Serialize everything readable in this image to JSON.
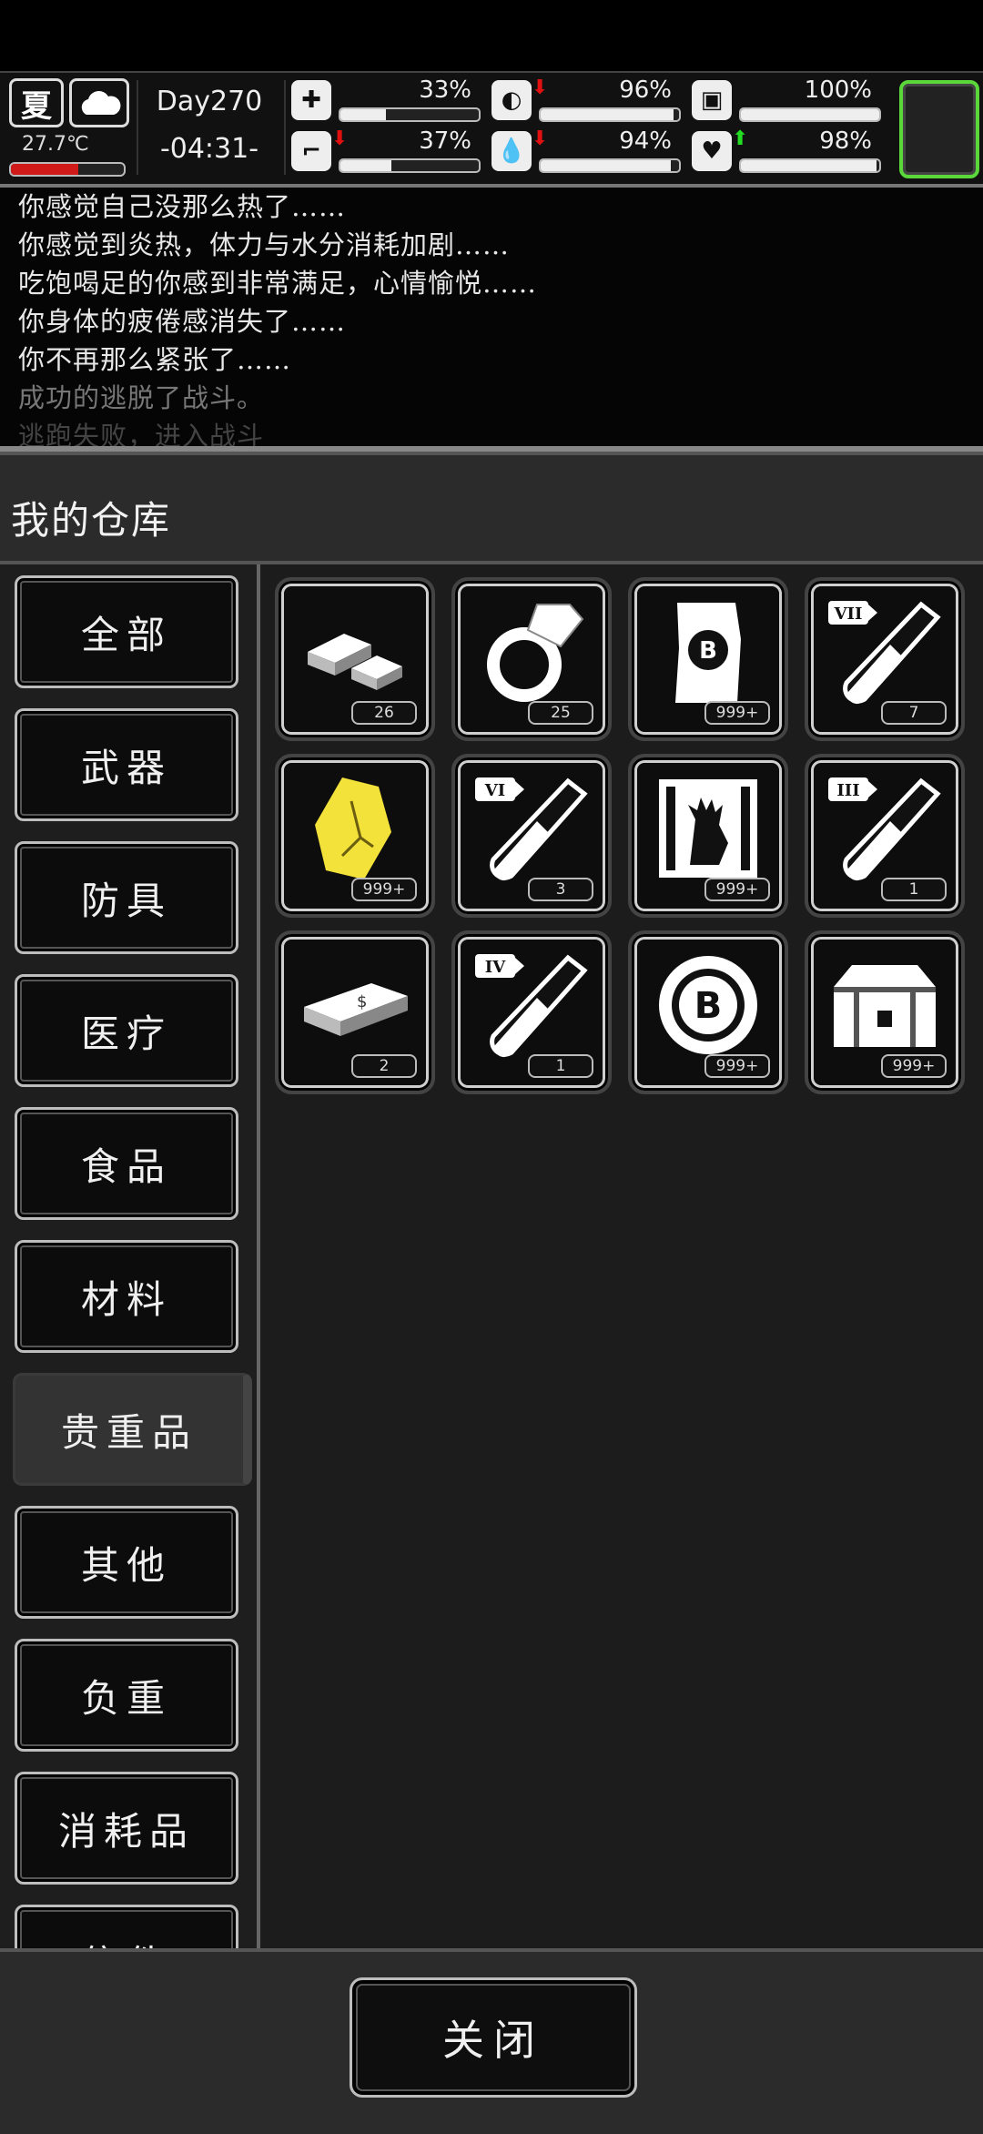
{
  "hud": {
    "season": "夏",
    "weather_icon": "cloud-icon",
    "temperature": "27.7℃",
    "temperature_level": 0.6,
    "day": "Day270",
    "clock": "-04:31-",
    "stats": [
      {
        "name": "health",
        "icon": "medkit-icon",
        "value": "33%",
        "level": 0.33,
        "trend": ""
      },
      {
        "name": "satiety",
        "icon": "stomach-icon",
        "value": "96%",
        "level": 0.96,
        "trend": "down"
      },
      {
        "name": "protection",
        "icon": "armor-icon",
        "value": "100%",
        "level": 1.0,
        "trend": ""
      },
      {
        "name": "stamina",
        "icon": "foot-icon",
        "value": "37%",
        "level": 0.37,
        "trend": "down"
      },
      {
        "name": "hydration",
        "icon": "water-drop-icon",
        "value": "94%",
        "level": 0.94,
        "trend": "down"
      },
      {
        "name": "mood",
        "icon": "heart-icon",
        "value": "98%",
        "level": 0.98,
        "trend": "up"
      }
    ],
    "colors": {
      "temp_bar": "#d01a1a",
      "trend_down": "#e01010",
      "trend_up": "#22dd22",
      "equip_border": "#5ad83a"
    }
  },
  "log": [
    "你感觉自己没那么热了……",
    "你感觉到炎热，体力与水分消耗加剧……",
    "吃饱喝足的你感到非常满足，心情愉悦……",
    "你身体的疲倦感消失了……",
    "你不再那么紧张了……",
    "成功的逃脱了战斗。",
    "逃跑失败，进入战斗"
  ],
  "storage": {
    "title": "我的仓库",
    "categories": [
      "全部",
      "武器",
      "防具",
      "医疗",
      "食品",
      "材料",
      "贵重品",
      "其他",
      "负重",
      "消耗品",
      "信件"
    ],
    "active_category": "贵重品",
    "items": [
      {
        "icon": "gold-bars-icon",
        "count": "26"
      },
      {
        "icon": "diamond-ring-icon",
        "count": "25"
      },
      {
        "icon": "coin-note-icon",
        "count": "999+"
      },
      {
        "icon": "test-tube-vii-icon",
        "label": "VII",
        "count": "7"
      },
      {
        "icon": "crystal-icon",
        "count": "999+"
      },
      {
        "icon": "test-tube-vi-icon",
        "label": "VI",
        "count": "3"
      },
      {
        "icon": "zombie-ticket-icon",
        "count": "999+"
      },
      {
        "icon": "test-tube-iii-icon",
        "label": "III",
        "count": "1"
      },
      {
        "icon": "cash-stack-icon",
        "count": "2"
      },
      {
        "icon": "test-tube-iv-icon",
        "label": "IV",
        "count": "1"
      },
      {
        "icon": "b-token-icon",
        "count": "999+"
      },
      {
        "icon": "treasure-chest-icon",
        "count": "999+"
      }
    ],
    "close_label": "关闭"
  }
}
